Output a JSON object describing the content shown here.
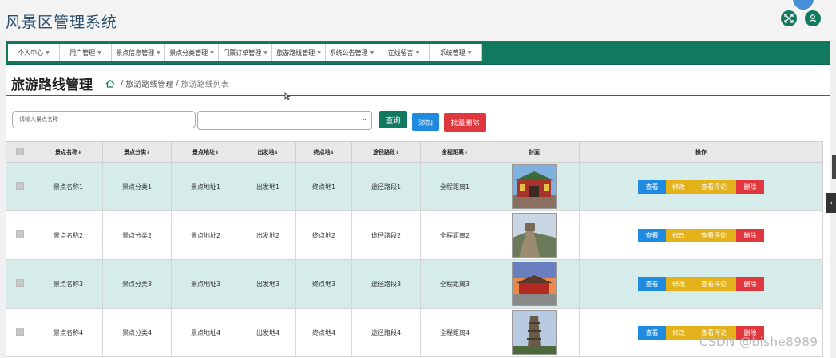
{
  "app": {
    "title": "风景区管理系统"
  },
  "nav": {
    "items": [
      {
        "label": "个人中心"
      },
      {
        "label": "用户管理"
      },
      {
        "label": "景点信息管理"
      },
      {
        "label": "景点分类管理"
      },
      {
        "label": "门票订单管理"
      },
      {
        "label": "旅游路线管理"
      },
      {
        "label": "系统公告管理"
      },
      {
        "label": "在线留言"
      },
      {
        "label": "系统管理"
      }
    ]
  },
  "page": {
    "title": "旅游路线管理",
    "breadcrumb": {
      "section": "旅游路线管理",
      "current": "旅游路线列表",
      "separator": "/"
    }
  },
  "filters": {
    "search_placeholder": "请输入景点名称",
    "select_value": "",
    "query_label": "查询",
    "add_label": "添加",
    "batch_delete_label": "批量删除"
  },
  "table": {
    "columns": [
      "景点名称",
      "景点分类",
      "景点地址",
      "出发地",
      "终点地",
      "途径路段",
      "全程距离",
      "封面",
      "操作"
    ],
    "sort_glyph": "⇕",
    "rows": [
      {
        "name": "景点名称1",
        "category": "景点分类1",
        "address": "景点地址1",
        "origin": "出发地1",
        "destination": "终点地1",
        "via": "途径路段1",
        "distance": "全程距离1",
        "cover": "gate-temple-image"
      },
      {
        "name": "景点名称2",
        "category": "景点分类2",
        "address": "景点地址2",
        "origin": "出发地2",
        "destination": "终点地2",
        "via": "途径路段2",
        "distance": "全程距离2",
        "cover": "great-wall-image"
      },
      {
        "name": "景点名称3",
        "category": "景点分类3",
        "address": "景点地址3",
        "origin": "出发地3",
        "destination": "终点地3",
        "via": "途径路段3",
        "distance": "全程距离3",
        "cover": "forbidden-city-image"
      },
      {
        "name": "景点名称4",
        "category": "景点分类4",
        "address": "景点地址4",
        "origin": "出发地4",
        "destination": "终点地4",
        "via": "途径路段4",
        "distance": "全程距离4",
        "cover": "pagoda-image"
      }
    ],
    "actions": {
      "view": "查看",
      "edit": "修改",
      "comments": "查看评论",
      "delete": "删除"
    }
  },
  "side_tab": {
    "glyph": "‹"
  },
  "watermark": "CSDN @bishe8989",
  "colors": {
    "brand": "#117a5e",
    "primary": "#1e8be0",
    "warning": "#e3b21a",
    "danger": "#e0363d",
    "row_highlight": "#d6ecea"
  }
}
